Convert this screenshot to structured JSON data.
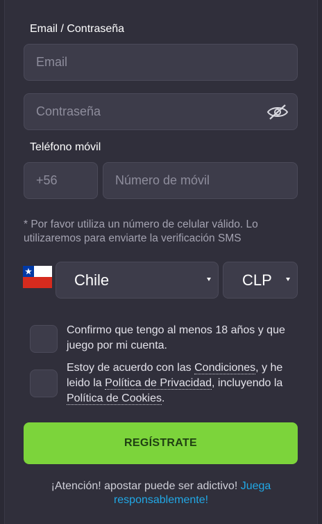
{
  "login_section": {
    "label": "Email / Contraseña",
    "email_placeholder": "Email",
    "password_placeholder": "Contraseña"
  },
  "phone_section": {
    "label": "Teléfono móvil",
    "country_code": "+56",
    "number_placeholder": "Número de móvil",
    "note": "* Por favor utiliza un número de celular válido. Lo utilizaremos para enviarte la verificación SMS"
  },
  "country_select": {
    "selected": "Chile",
    "flag": "chile-flag-icon"
  },
  "currency_select": {
    "selected": "CLP"
  },
  "age_checkbox": {
    "text": "Confirmo que tengo al menos 18 años y que juego por mi cuenta."
  },
  "terms_checkbox": {
    "text_1": "Estoy de acuerdo con las ",
    "link_conditions": "Condiciones",
    "text_2": ", y he leido la ",
    "link_privacy": "Política de Privacidad",
    "text_3": ", incluyendo la ",
    "link_cookies": "Política de Cookies",
    "text_4": "."
  },
  "register_button": {
    "label": "REGÍSTRATE",
    "color": "#7cd43b"
  },
  "warning": {
    "text": "¡Atención! apostar puede ser adictivo! ",
    "link": "Juega responsablemente!",
    "link_color": "#21a8e6"
  }
}
